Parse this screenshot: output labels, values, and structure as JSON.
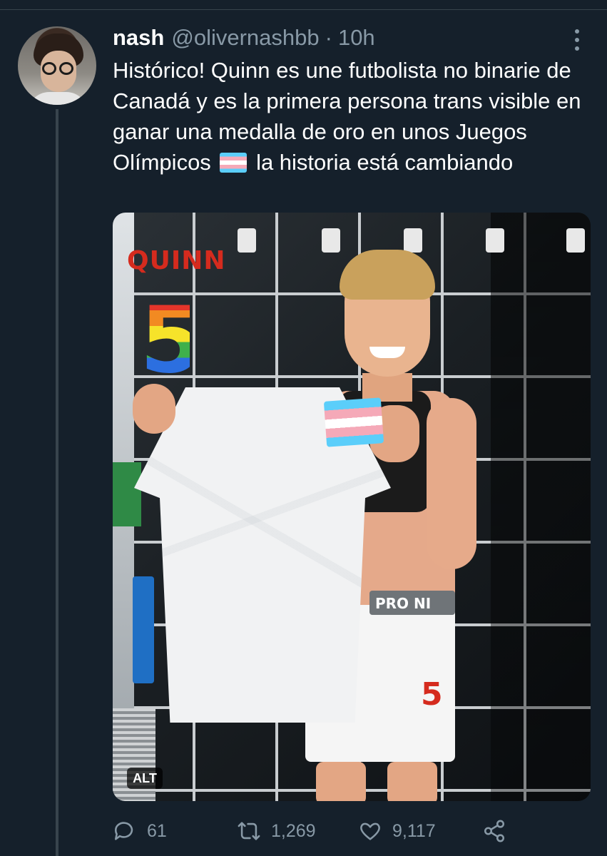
{
  "tweet": {
    "display_name": "nash",
    "handle": "@olivernashbb",
    "separator": "·",
    "time": "10h",
    "text_before_emoji": "Histórico! Quinn es une futbolista no binarie de Canadá y es la primera persona trans visible en ganar una medalla de oro en unos Juegos Olímpicos",
    "emoji": "transgender-flag",
    "text_after_emoji": "la historia está cambiando"
  },
  "media": {
    "alt_badge": "ALT",
    "jersey_name": "QUINN",
    "jersey_number": "5",
    "shorts_brand": "PRO NI",
    "shorts_number": "5"
  },
  "actions": {
    "reply_count": "61",
    "retweet_count": "1,269",
    "like_count": "9,117"
  },
  "icons": [
    "more-icon",
    "reply-icon",
    "retweet-icon",
    "like-icon",
    "share-icon"
  ],
  "colors": {
    "background": "#15202b",
    "secondary_text": "#8899a6",
    "divider": "#38444d"
  }
}
